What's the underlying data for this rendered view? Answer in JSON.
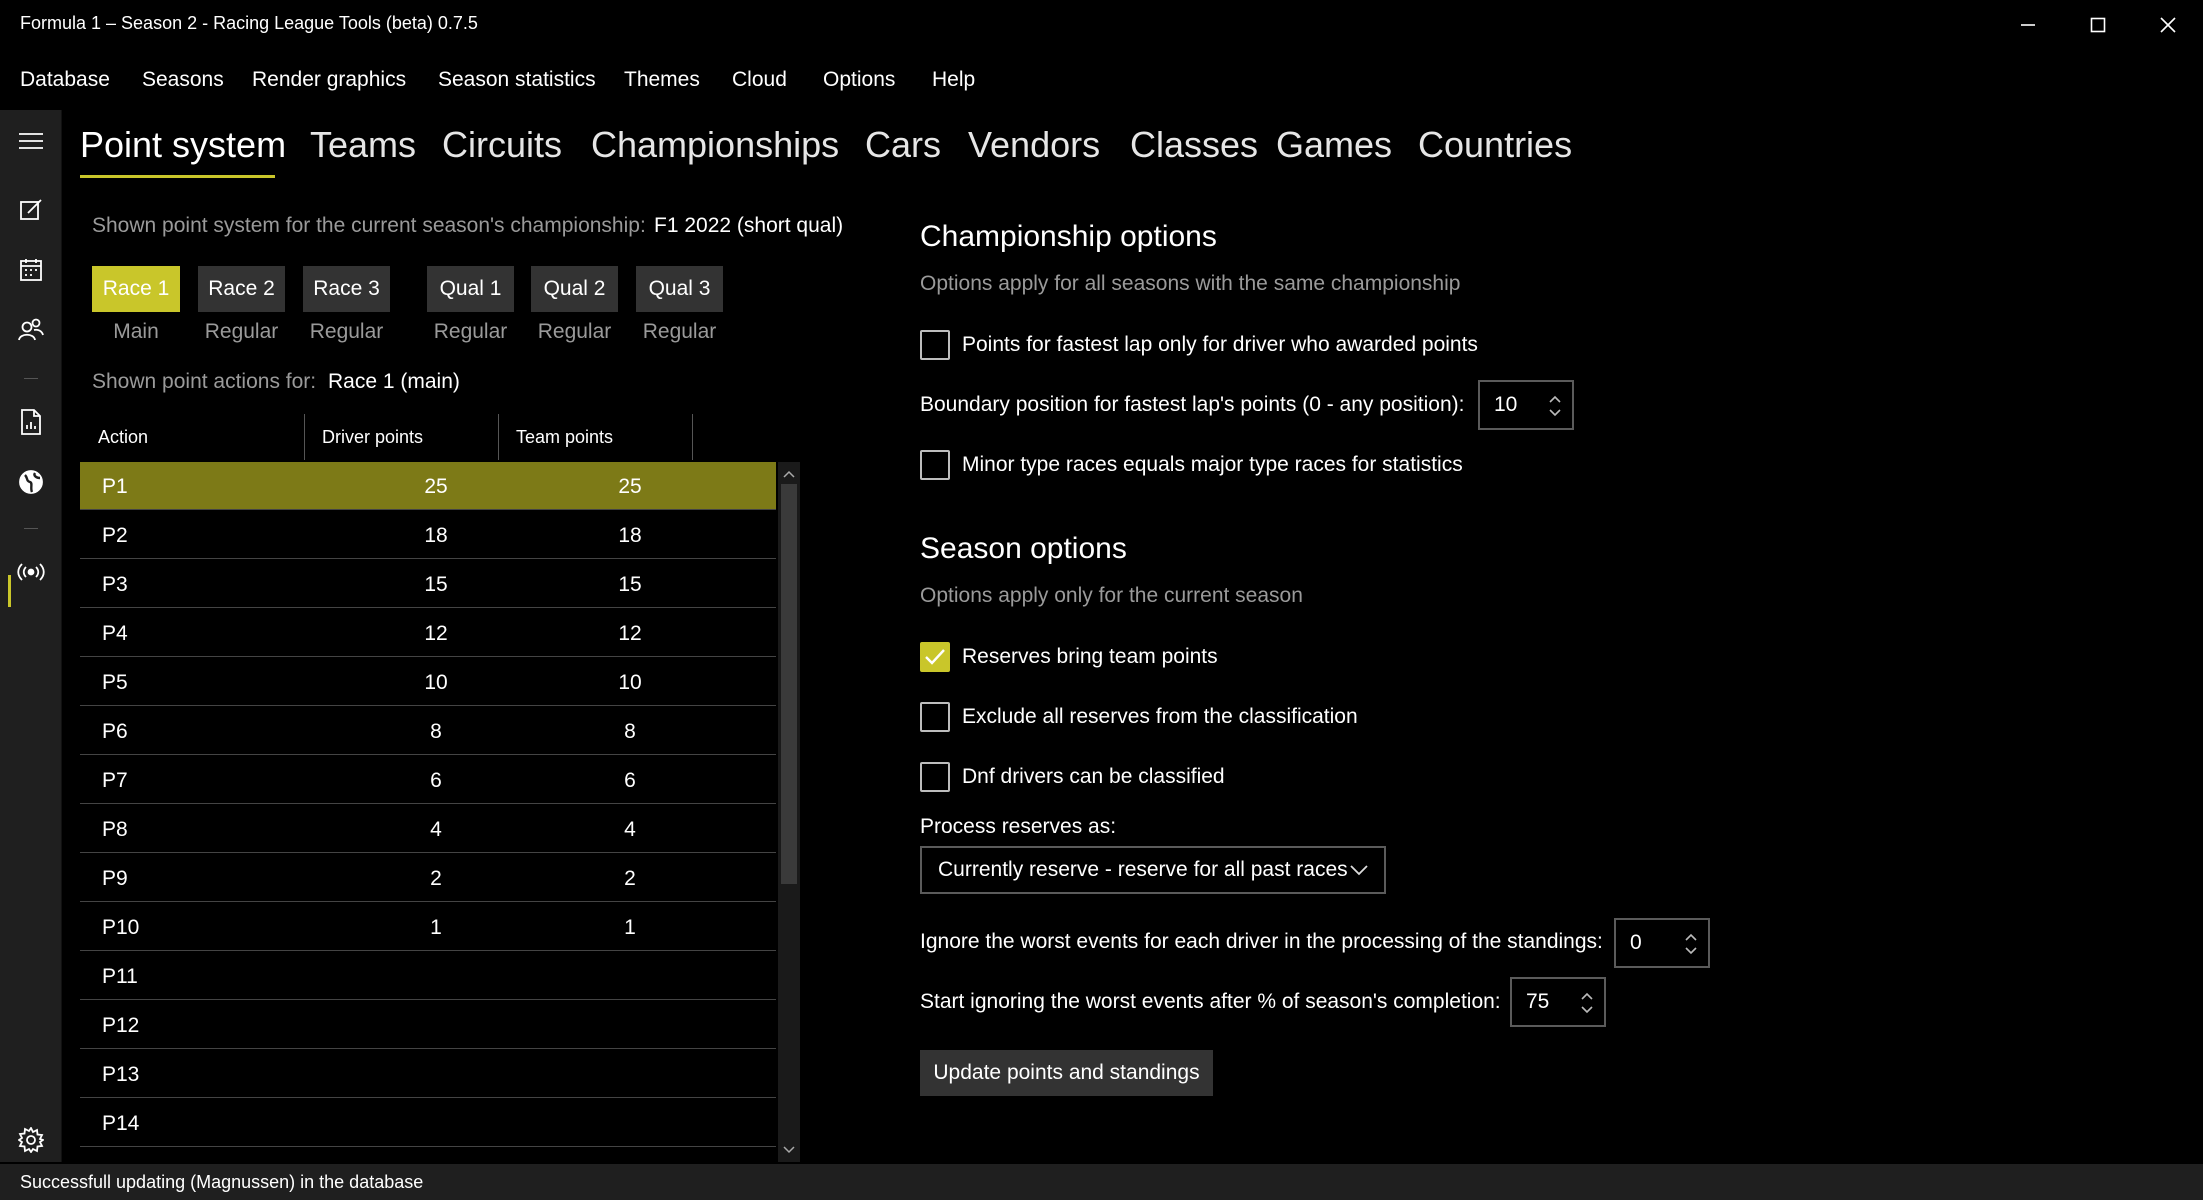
{
  "window": {
    "title": "Formula 1 – Season 2 - Racing League Tools (beta) 0.7.5"
  },
  "menu": [
    "Database",
    "Seasons",
    "Render graphics",
    "Season statistics",
    "Themes",
    "Cloud",
    "Options",
    "Help"
  ],
  "rail_icons": [
    "menu-icon",
    "edit-icon",
    "calendar-icon",
    "people-icon",
    "report-icon",
    "globe-icon",
    "broadcast-icon",
    "gear-icon"
  ],
  "tabs": [
    "Point system",
    "Teams",
    "Circuits",
    "Championships",
    "Cars",
    "Vendors",
    "Classes",
    "Games",
    "Countries"
  ],
  "point_system": {
    "label": "Shown point system for the current season's championship:",
    "value": "F1 2022 (short qual)",
    "races": [
      {
        "label": "Race 1",
        "sub": "Main",
        "selected": true
      },
      {
        "label": "Race 2",
        "sub": "Regular",
        "selected": false
      },
      {
        "label": "Race 3",
        "sub": "Regular",
        "selected": false
      },
      {
        "label": "Qual 1",
        "sub": "Regular",
        "selected": false
      },
      {
        "label": "Qual 2",
        "sub": "Regular",
        "selected": false
      },
      {
        "label": "Qual 3",
        "sub": "Regular",
        "selected": false
      }
    ],
    "actions_label": "Shown point actions for:",
    "actions_value": "Race 1 (main)"
  },
  "grid": {
    "columns": [
      "Action",
      "Driver points",
      "Team points"
    ],
    "rows": [
      {
        "action": "P1",
        "driver": "25",
        "team": "25"
      },
      {
        "action": "P2",
        "driver": "18",
        "team": "18"
      },
      {
        "action": "P3",
        "driver": "15",
        "team": "15"
      },
      {
        "action": "P4",
        "driver": "12",
        "team": "12"
      },
      {
        "action": "P5",
        "driver": "10",
        "team": "10"
      },
      {
        "action": "P6",
        "driver": "8",
        "team": "8"
      },
      {
        "action": "P7",
        "driver": "6",
        "team": "6"
      },
      {
        "action": "P8",
        "driver": "4",
        "team": "4"
      },
      {
        "action": "P9",
        "driver": "2",
        "team": "2"
      },
      {
        "action": "P10",
        "driver": "1",
        "team": "1"
      },
      {
        "action": "P11",
        "driver": "",
        "team": ""
      },
      {
        "action": "P12",
        "driver": "",
        "team": ""
      },
      {
        "action": "P13",
        "driver": "",
        "team": ""
      },
      {
        "action": "P14",
        "driver": "",
        "team": ""
      }
    ]
  },
  "championship_options": {
    "title": "Championship options",
    "subtitle": "Options apply for all seasons with the same championship",
    "fastest_lap_only_points": {
      "label": "Points for fastest lap only for driver who awarded points",
      "checked": false
    },
    "boundary_label": "Boundary position for fastest lap's points (0 - any position):",
    "boundary_value": "10",
    "minor_equals_major": {
      "label": "Minor type races equals major type races for statistics",
      "checked": false
    }
  },
  "season_options": {
    "title": "Season options",
    "subtitle": "Options apply only for the current season",
    "reserves_team_points": {
      "label": "Reserves bring team points",
      "checked": true
    },
    "exclude_reserves": {
      "label": "Exclude all reserves from the classification",
      "checked": false
    },
    "dnf_classified": {
      "label": "Dnf drivers can be classified",
      "checked": false
    },
    "process_reserves_label": "Process reserves as:",
    "process_reserves_value": "Currently reserve - reserve for all past races",
    "ignore_worst_label": "Ignore the worst events for each driver in the processing of the standings:",
    "ignore_worst_value": "0",
    "start_ignoring_label": "Start ignoring the worst events after % of season's completion:",
    "start_ignoring_value": "75",
    "update_button": "Update points and standings"
  },
  "status": "Successfull updating (Magnussen) in the database",
  "colors": {
    "accent": "#c9c62a",
    "selected_row": "#7d7a17",
    "background": "#000000"
  }
}
